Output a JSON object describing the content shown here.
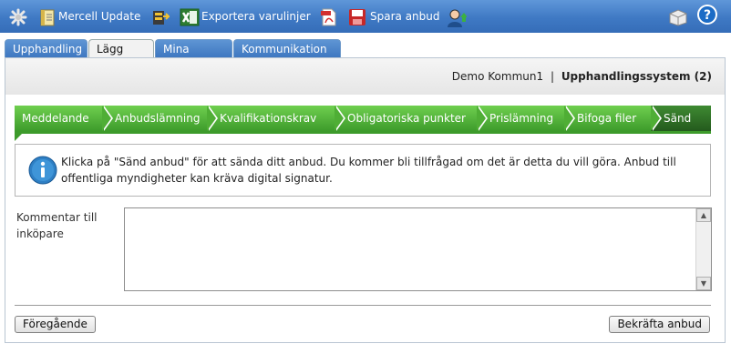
{
  "toolbar": {
    "mercell_update_label": "Mercell Update",
    "export_label": "Exportera varulinjer",
    "save_label": "Spara anbud",
    "icons": [
      "settings-icon",
      "mercell-update-icon",
      "export-arrow-icon",
      "excel-icon",
      "pdf-icon",
      "save-disk-icon",
      "user-upload-icon",
      "package-icon",
      "help-icon"
    ]
  },
  "tabs": [
    "Upphandling",
    "Lägg bud",
    "Mina anbud",
    "Kommunikation"
  ],
  "active_tab": "Lägg bud",
  "header": {
    "company": "Demo Kommun1",
    "separator": "|",
    "system": "Upphandlingssystem (2)"
  },
  "steps": [
    "Meddelande",
    "Anbudslämning",
    "Kvalifikationskrav",
    "Obligatoriska punkter",
    "Prislämning",
    "Bifoga filer",
    "Sänd"
  ],
  "active_step": "Sänd",
  "info": {
    "text": "Klicka på \"Sänd anbud\" för att sända ditt anbud. Du kommer bli tillfrågad om det är detta du vill göra. Anbud till offentliga myndigheter kan kräva digital signatur."
  },
  "comment": {
    "label": "Kommentar till inköpare",
    "value": ""
  },
  "buttons": {
    "previous": "Föregående",
    "confirm": "Bekräfta anbud"
  },
  "colors": {
    "toolbar": "#3f79c4",
    "step_green": "#3d9b2b",
    "step_active": "#245a1d",
    "info_icon": "#2e7fc4"
  }
}
